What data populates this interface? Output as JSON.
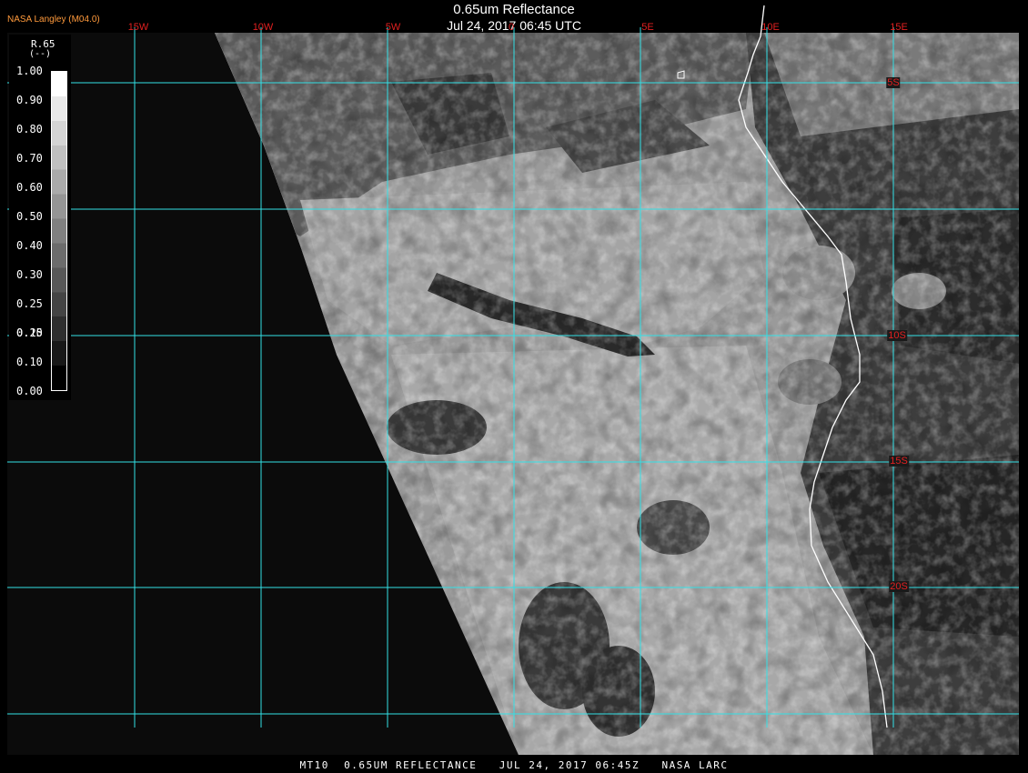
{
  "header": {
    "title": "0.65um Reflectance",
    "datetime": "Jul 24, 2017 06:45 UTC",
    "agency": "NASA Langley (M04.0)"
  },
  "legend": {
    "variable": "R.65",
    "unit": "(--)",
    "ticks": [
      "1.00",
      "0.90",
      "0.80",
      "0.70",
      "0.60",
      "0.50",
      "0.40",
      "0.30",
      "0.25",
      "0.20",
      "0.15",
      "0.10",
      "0.00"
    ]
  },
  "grid": {
    "color": "#33e0e6",
    "label_color": "#e02020",
    "lon_labels": [
      "15W",
      "10W",
      "5W",
      "0",
      "5E",
      "10E",
      "15E"
    ],
    "lat_labels": [
      "5S",
      "10S",
      "15S",
      "20S"
    ]
  },
  "footer": "MT10  0.65UM REFLECTANCE   JUL 24, 2017 06:45Z   NASA LARC"
}
